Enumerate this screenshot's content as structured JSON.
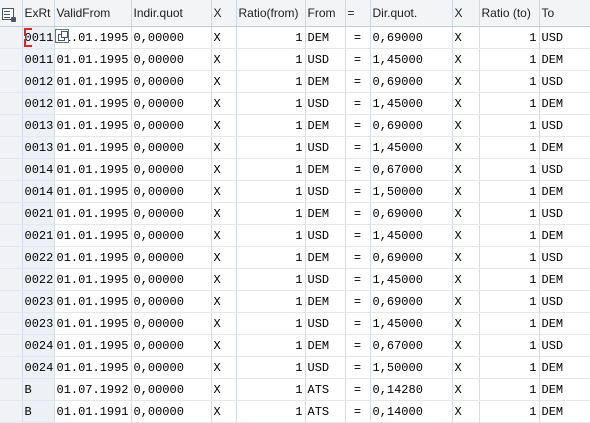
{
  "columns": {
    "exrt": "ExRt",
    "valid_from": "ValidFrom",
    "indir_quot": "Indir.quot",
    "x1": "X",
    "ratio_from": "Ratio(from)",
    "from": "From",
    "eq": "=",
    "dir_quot": "Dir.quot.",
    "x2": "X",
    "ratio_to": "Ratio (to)",
    "to": "To"
  },
  "rows": [
    {
      "exrt": "0011",
      "valid": "01.01.1995",
      "indir": "0,00000",
      "x1": "X",
      "ratio_from": "1",
      "from": "DEM",
      "eq": "=",
      "dir": "0,69000",
      "x2": "X",
      "ratio_to": "1",
      "to": "USD"
    },
    {
      "exrt": "0011",
      "valid": "01.01.1995",
      "indir": "0,00000",
      "x1": "X",
      "ratio_from": "1",
      "from": "USD",
      "eq": "=",
      "dir": "1,45000",
      "x2": "X",
      "ratio_to": "1",
      "to": "DEM"
    },
    {
      "exrt": "0012",
      "valid": "01.01.1995",
      "indir": "0,00000",
      "x1": "X",
      "ratio_from": "1",
      "from": "DEM",
      "eq": "=",
      "dir": "0,69000",
      "x2": "X",
      "ratio_to": "1",
      "to": "USD"
    },
    {
      "exrt": "0012",
      "valid": "01.01.1995",
      "indir": "0,00000",
      "x1": "X",
      "ratio_from": "1",
      "from": "USD",
      "eq": "=",
      "dir": "1,45000",
      "x2": "X",
      "ratio_to": "1",
      "to": "DEM"
    },
    {
      "exrt": "0013",
      "valid": "01.01.1995",
      "indir": "0,00000",
      "x1": "X",
      "ratio_from": "1",
      "from": "DEM",
      "eq": "=",
      "dir": "0,69000",
      "x2": "X",
      "ratio_to": "1",
      "to": "USD"
    },
    {
      "exrt": "0013",
      "valid": "01.01.1995",
      "indir": "0,00000",
      "x1": "X",
      "ratio_from": "1",
      "from": "USD",
      "eq": "=",
      "dir": "1,45000",
      "x2": "X",
      "ratio_to": "1",
      "to": "DEM"
    },
    {
      "exrt": "0014",
      "valid": "01.01.1995",
      "indir": "0,00000",
      "x1": "X",
      "ratio_from": "1",
      "from": "DEM",
      "eq": "=",
      "dir": "0,67000",
      "x2": "X",
      "ratio_to": "1",
      "to": "USD"
    },
    {
      "exrt": "0014",
      "valid": "01.01.1995",
      "indir": "0,00000",
      "x1": "X",
      "ratio_from": "1",
      "from": "USD",
      "eq": "=",
      "dir": "1,50000",
      "x2": "X",
      "ratio_to": "1",
      "to": "DEM"
    },
    {
      "exrt": "0021",
      "valid": "01.01.1995",
      "indir": "0,00000",
      "x1": "X",
      "ratio_from": "1",
      "from": "DEM",
      "eq": "=",
      "dir": "0,69000",
      "x2": "X",
      "ratio_to": "1",
      "to": "USD"
    },
    {
      "exrt": "0021",
      "valid": "01.01.1995",
      "indir": "0,00000",
      "x1": "X",
      "ratio_from": "1",
      "from": "USD",
      "eq": "=",
      "dir": "1,45000",
      "x2": "X",
      "ratio_to": "1",
      "to": "DEM"
    },
    {
      "exrt": "0022",
      "valid": "01.01.1995",
      "indir": "0,00000",
      "x1": "X",
      "ratio_from": "1",
      "from": "DEM",
      "eq": "=",
      "dir": "0,69000",
      "x2": "X",
      "ratio_to": "1",
      "to": "USD"
    },
    {
      "exrt": "0022",
      "valid": "01.01.1995",
      "indir": "0,00000",
      "x1": "X",
      "ratio_from": "1",
      "from": "USD",
      "eq": "=",
      "dir": "1,45000",
      "x2": "X",
      "ratio_to": "1",
      "to": "DEM"
    },
    {
      "exrt": "0023",
      "valid": "01.01.1995",
      "indir": "0,00000",
      "x1": "X",
      "ratio_from": "1",
      "from": "DEM",
      "eq": "=",
      "dir": "0,69000",
      "x2": "X",
      "ratio_to": "1",
      "to": "USD"
    },
    {
      "exrt": "0023",
      "valid": "01.01.1995",
      "indir": "0,00000",
      "x1": "X",
      "ratio_from": "1",
      "from": "USD",
      "eq": "=",
      "dir": "1,45000",
      "x2": "X",
      "ratio_to": "1",
      "to": "DEM"
    },
    {
      "exrt": "0024",
      "valid": "01.01.1995",
      "indir": "0,00000",
      "x1": "X",
      "ratio_from": "1",
      "from": "DEM",
      "eq": "=",
      "dir": "0,67000",
      "x2": "X",
      "ratio_to": "1",
      "to": "USD"
    },
    {
      "exrt": "0024",
      "valid": "01.01.1995",
      "indir": "0,00000",
      "x1": "X",
      "ratio_from": "1",
      "from": "USD",
      "eq": "=",
      "dir": "1,50000",
      "x2": "X",
      "ratio_to": "1",
      "to": "DEM"
    },
    {
      "exrt": "B",
      "valid": "01.07.1992",
      "indir": "0,00000",
      "x1": "X",
      "ratio_from": "1",
      "from": "ATS",
      "eq": "=",
      "dir": "0,14280",
      "x2": "X",
      "ratio_to": "1",
      "to": "DEM"
    },
    {
      "exrt": "B",
      "valid": "01.01.1991",
      "indir": "0,00000",
      "x1": "X",
      "ratio_from": "1",
      "from": "ATS",
      "eq": "=",
      "dir": "0,14000",
      "x2": "X",
      "ratio_to": "1",
      "to": "DEM"
    }
  ],
  "icons": {
    "table_settings": "table-settings-icon",
    "copy": "copy-icon"
  },
  "colors": {
    "header_bg": "#f2f4f6",
    "key_col_bg": "#edf1f6",
    "selection_marker": "#d7262a"
  }
}
